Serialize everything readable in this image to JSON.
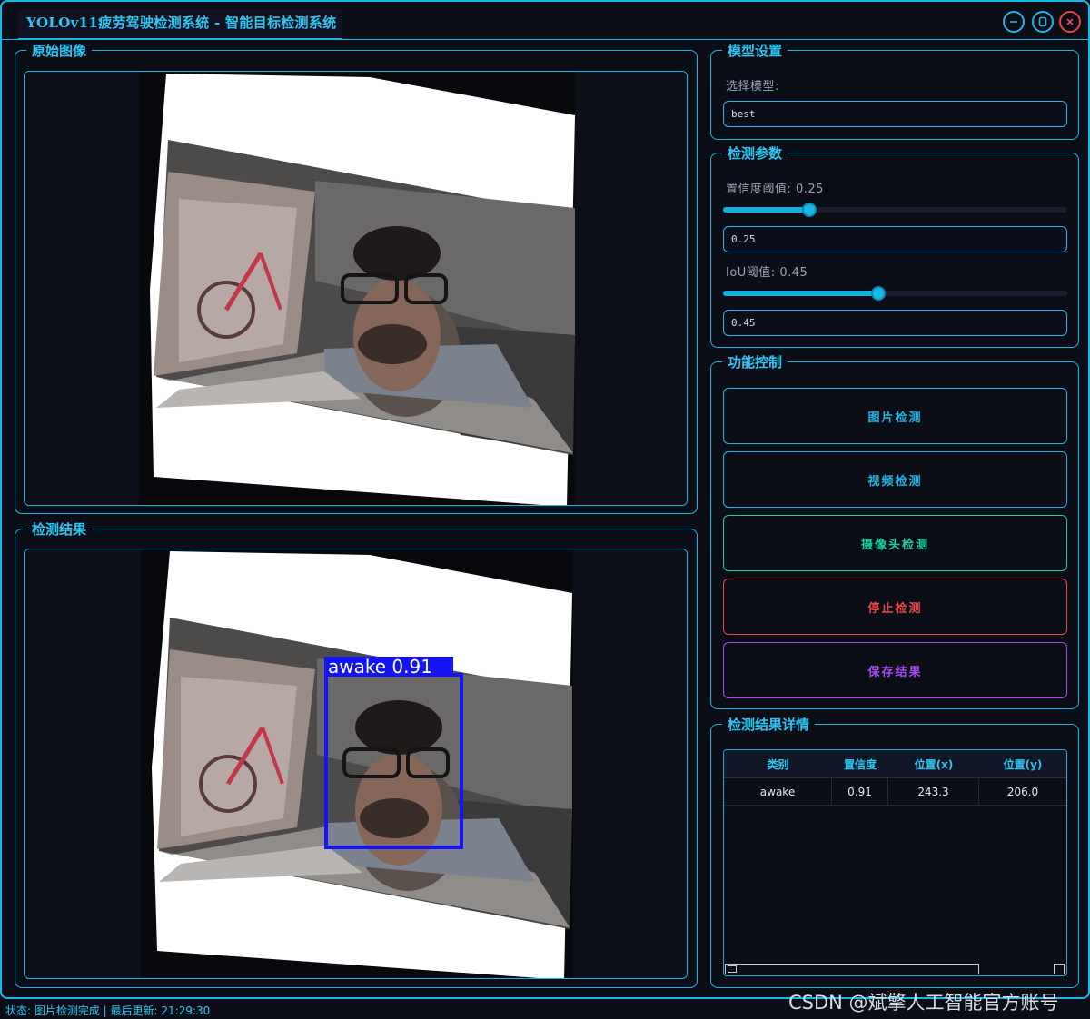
{
  "window": {
    "title": "YOLOv11疲劳驾驶检测系统 - 智能目标检测系统",
    "controls": [
      "minimize-icon",
      "maximize-icon",
      "close-icon"
    ]
  },
  "panels": {
    "original_title": "原始图像",
    "result_title": "检测结果"
  },
  "detection_overlay": {
    "label": "awake 0.91",
    "box_color": "#1414f5"
  },
  "model_settings": {
    "title": "模型设置",
    "select_label": "选择模型:",
    "selected_model": "best"
  },
  "params": {
    "title": "检测参数",
    "conf_label": "置信度阈值: 0.25",
    "conf_value": 0.25,
    "conf_input": "0.25",
    "iou_label": "IoU阈值: 0.45",
    "iou_value": 0.45,
    "iou_input": "0.45"
  },
  "controls": {
    "title": "功能控制",
    "buttons": [
      {
        "label": "图片检测",
        "color": "#1fb6e6"
      },
      {
        "label": "视频检测",
        "color": "#1fb6e6"
      },
      {
        "label": "摄像头检测",
        "color": "#1fcf9a"
      },
      {
        "label": "停止检测",
        "color": "#ee4747"
      },
      {
        "label": "保存结果",
        "color": "#a44df0"
      }
    ]
  },
  "results": {
    "title": "检测结果详情",
    "columns": [
      "类别",
      "置信度",
      "位置(x)",
      "位置(y)"
    ],
    "rows": [
      [
        "awake",
        "0.91",
        "243.3",
        "206.0"
      ]
    ]
  },
  "status": {
    "text": "状态: 图片检测完成 | 最后更新: 21:29:30"
  },
  "watermark": "CSDN @斌擎人工智能官方账号",
  "colors": {
    "accent": "#16b8e8",
    "background": "#0b0d17"
  }
}
